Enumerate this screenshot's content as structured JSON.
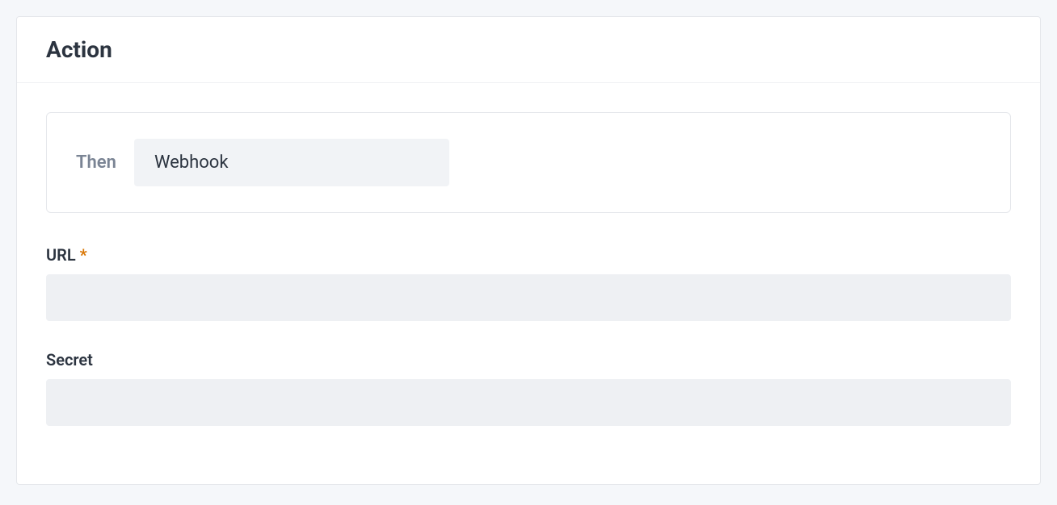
{
  "section": {
    "title": "Action"
  },
  "action": {
    "then_label": "Then",
    "selected": "Webhook"
  },
  "fields": {
    "url": {
      "label": "URL",
      "required_marker": "*",
      "value": ""
    },
    "secret": {
      "label": "Secret",
      "value": ""
    }
  }
}
